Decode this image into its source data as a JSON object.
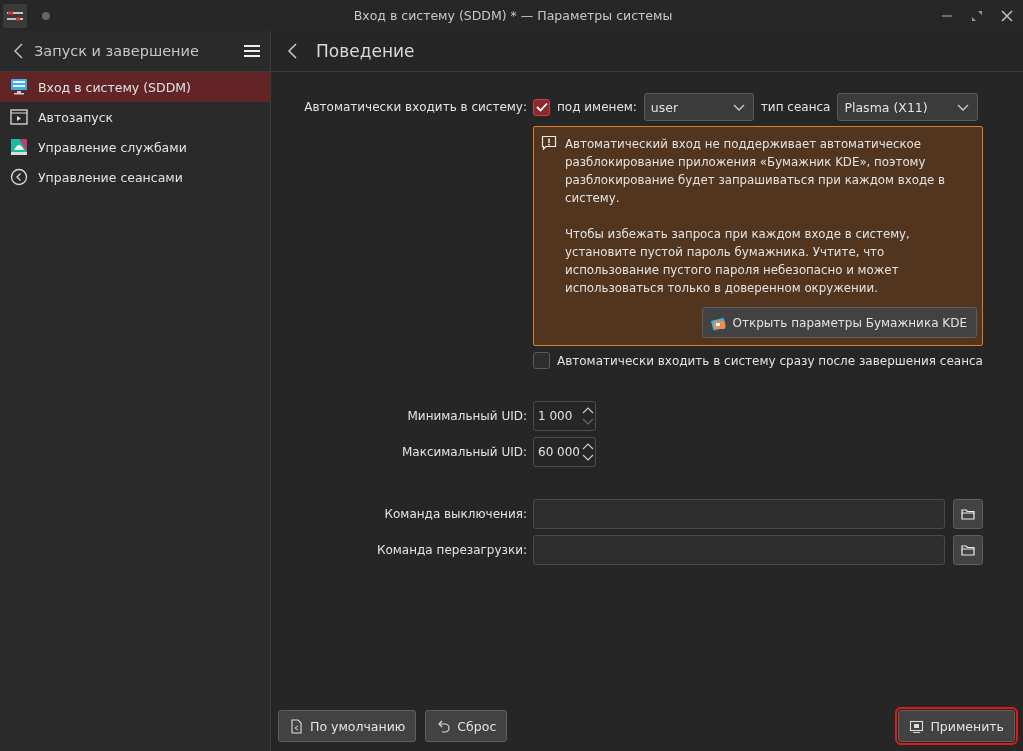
{
  "window": {
    "title": "Вход в систему (SDDM) * — Параметры системы"
  },
  "sidebar": {
    "title": "Запуск и завершение",
    "items": [
      {
        "label": "Вход в систему (SDDM)",
        "selected": true
      },
      {
        "label": "Автозапуск",
        "selected": false
      },
      {
        "label": "Управление службами",
        "selected": false
      },
      {
        "label": "Управление сеансами",
        "selected": false
      }
    ]
  },
  "page": {
    "title": "Поведение"
  },
  "autologin": {
    "label": "Автоматически входить в систему:",
    "checked": true,
    "user_label": "под именем:",
    "user": "user",
    "session_label": "тип сеанса",
    "session": "Plasma (X11)"
  },
  "warning": {
    "paragraphs": [
      "Автоматический вход не поддерживает автоматическое разблокирование приложения «Бумажник KDE», поэтому разблокирование будет запрашиваться при каждом входе в систему.",
      "Чтобы избежать запроса при каждом входе в систему, установите пустой пароль бумажника. Учтите, что использование пустого пароля небезопасно и может использоваться только в доверенном окружении."
    ],
    "button": "Открыть параметры Бумажника KDE"
  },
  "relogin": {
    "label": "Автоматически входить в систему сразу после завершения сеанса",
    "checked": false
  },
  "uids": [
    {
      "label": "Минимальный UID:",
      "value": "1 000"
    },
    {
      "label": "Максимальный UID:",
      "value": "60 000"
    }
  ],
  "commands": [
    {
      "label": "Команда выключения:"
    },
    {
      "label": "Команда перезагрузки:"
    }
  ],
  "footer": {
    "buttons": [
      {
        "label": "По умолчанию",
        "kind": "defaults",
        "focused": false
      },
      {
        "label": "Сброс",
        "kind": "reset",
        "focused": false
      },
      {
        "label": "Применить",
        "kind": "apply",
        "focused": true
      }
    ]
  }
}
